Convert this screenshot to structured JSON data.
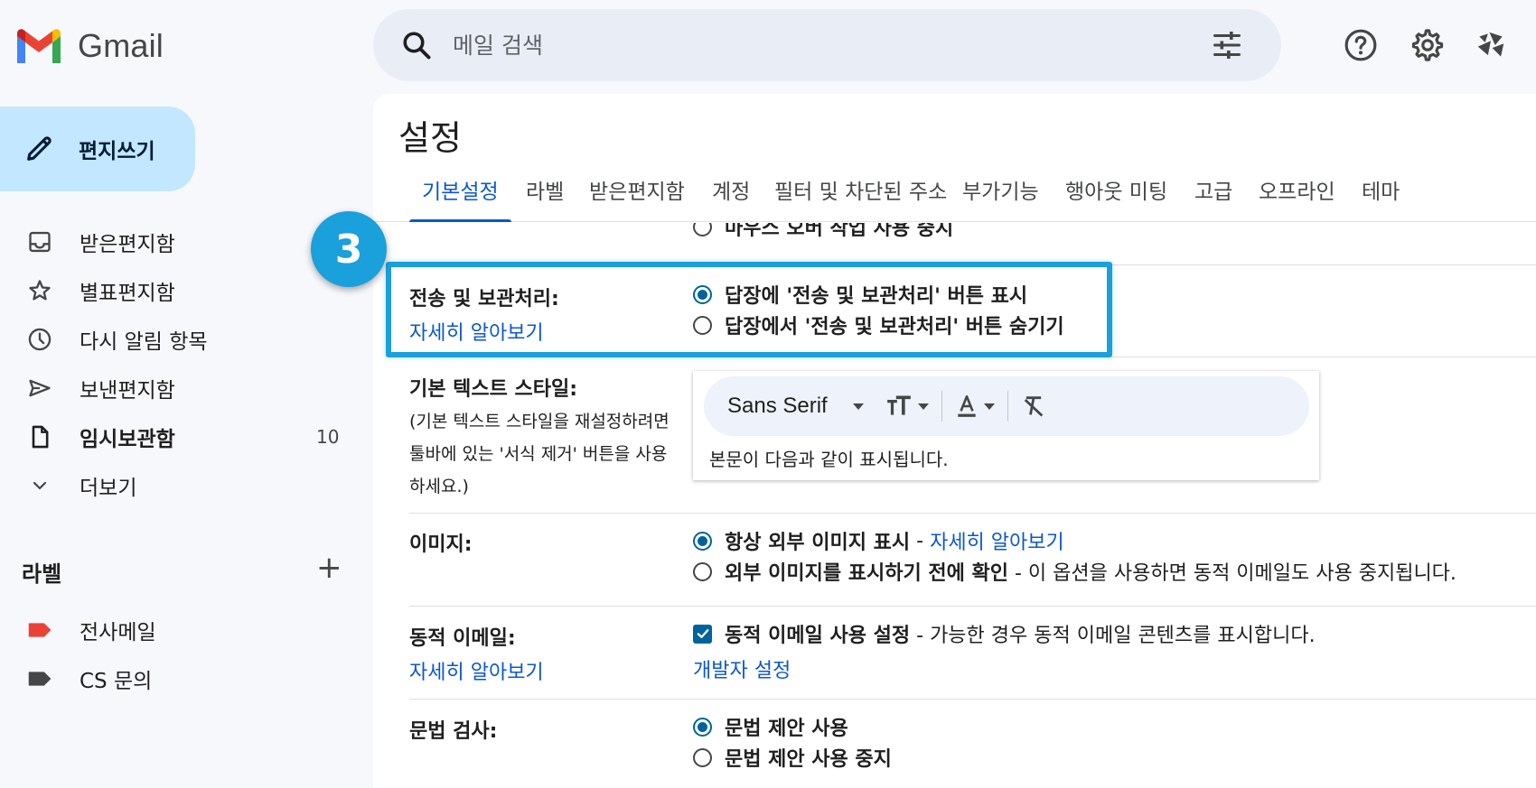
{
  "app": {
    "name": "Gmail"
  },
  "search": {
    "placeholder": "메일 검색"
  },
  "compose": {
    "label": "편지쓰기"
  },
  "sidebar": {
    "items": [
      {
        "label": "받은편지함",
        "count": ""
      },
      {
        "label": "별표편지함",
        "count": ""
      },
      {
        "label": "다시 알림 항목",
        "count": ""
      },
      {
        "label": "보낸편지함",
        "count": ""
      },
      {
        "label": "임시보관함",
        "count": "10"
      },
      {
        "label": "더보기",
        "count": ""
      }
    ],
    "labels_title": "라벨",
    "labels": [
      {
        "name": "전사메일",
        "color": "#ea4335"
      },
      {
        "name": "CS 문의",
        "color": "#444746"
      }
    ]
  },
  "settings": {
    "title": "설정",
    "tabs": [
      "기본설정",
      "라벨",
      "받은편지함",
      "계정",
      "필터 및 차단된 주소",
      "부가기능",
      "행아웃 미팅",
      "고급",
      "오프라인",
      "테마"
    ],
    "cut_option": "마우스 오버 작업 사용 중지",
    "send_archive": {
      "label": "전송 및 보관처리:",
      "link": "자세히 알아보기",
      "options": [
        "답장에 '전송 및 보관처리' 버튼 표시",
        "답장에서 '전송 및 보관처리' 버튼 숨기기"
      ]
    },
    "text_style": {
      "label": "기본 텍스트 스타일:",
      "desc_lines": [
        "(기본 텍스트 스타일을 재설정하려면",
        "툴바에 있는 '서식 제거' 버튼을 사용",
        "하세요.)"
      ],
      "font": "Sans Serif",
      "sample": "본문이 다음과 같이 표시됩니다."
    },
    "images": {
      "label": "이미지:",
      "opt1": "항상 외부 이미지 표시",
      "opt1_sep": " - ",
      "opt1_link": "자세히 알아보기",
      "opt2": "외부 이미지를 표시하기 전에 확인",
      "opt2_desc": " - 이 옵션을 사용하면 동적 이메일도 사용 중지됩니다."
    },
    "dynamic_email": {
      "label": "동적 이메일:",
      "link": "자세히 알아보기",
      "opt": "동적 이메일 사용 설정",
      "opt_desc": " - 가능한 경우 동적 이메일 콘텐츠를 표시합니다.",
      "dev_link": "개발자 설정"
    },
    "grammar": {
      "label": "문법 검사:",
      "options": [
        "문법 제안 사용",
        "문법 제안 사용 중지"
      ]
    }
  },
  "annotation": {
    "step": "3",
    "color": "#1aa0db"
  }
}
